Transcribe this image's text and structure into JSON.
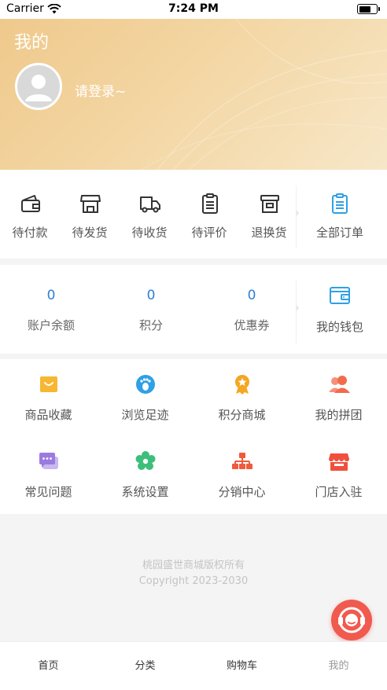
{
  "status_bar": {
    "carrier": "Carrier",
    "time": "7:24 PM"
  },
  "header": {
    "title": "我的",
    "login_prompt": "请登录~"
  },
  "orders": {
    "items": [
      {
        "label": "待付款",
        "icon": "wallet-icon"
      },
      {
        "label": "待发货",
        "icon": "store-icon"
      },
      {
        "label": "待收货",
        "icon": "truck-icon"
      },
      {
        "label": "待评价",
        "icon": "clipboard-icon"
      },
      {
        "label": "退换货",
        "icon": "archive-box-icon"
      }
    ],
    "all_label": "全部订单"
  },
  "wallet": {
    "items": [
      {
        "value": "0",
        "label": "账户余额"
      },
      {
        "value": "0",
        "label": "积分"
      },
      {
        "value": "0",
        "label": "优惠券"
      }
    ],
    "my_wallet_label": "我的钱包"
  },
  "services": [
    {
      "label": "商品收藏",
      "icon": "favorites-bag-icon",
      "color": "#f7b733"
    },
    {
      "label": "浏览足迹",
      "icon": "footprint-icon",
      "color": "#2fa0e6"
    },
    {
      "label": "积分商城",
      "icon": "medal-icon",
      "color": "#f5a623"
    },
    {
      "label": "我的拼团",
      "icon": "group-users-icon",
      "color": "#f26b4d"
    },
    {
      "label": "常见问题",
      "icon": "chat-bubble-icon",
      "color": "#9b7be0"
    },
    {
      "label": "系统设置",
      "icon": "gear-flower-icon",
      "color": "#3bbf7a"
    },
    {
      "label": "分销中心",
      "icon": "hierarchy-icon",
      "color": "#f05a3c"
    },
    {
      "label": "门店入驻",
      "icon": "storefront-icon",
      "color": "#f0503c"
    }
  ],
  "copyright": {
    "line1": "桃园盛世商城版权所有",
    "line2": "Copyright 2023-2030"
  },
  "tabs": [
    {
      "label": "首页"
    },
    {
      "label": "分类"
    },
    {
      "label": "购物车"
    },
    {
      "label": "我的"
    }
  ],
  "colors": {
    "accent_blue": "#2f80d6",
    "support_red": "#f05a4f"
  }
}
